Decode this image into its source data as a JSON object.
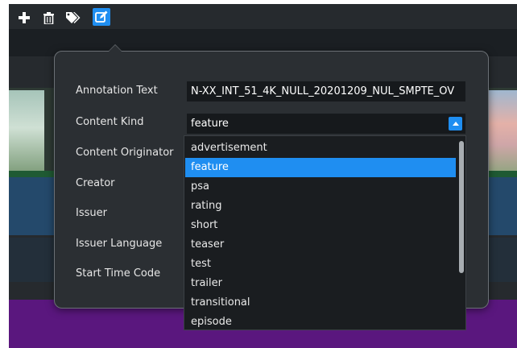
{
  "toolbar": {
    "icons": [
      "plus-icon",
      "trash-icon",
      "tags-icon",
      "edit-icon"
    ],
    "active_icon": "edit-icon"
  },
  "form": {
    "annotation_text_label": "Annotation Text",
    "annotation_text_value": "N-XX_INT_51_4K_NULL_20201209_NUL_SMPTE_OV",
    "content_kind_label": "Content Kind",
    "content_kind_value": "feature",
    "content_originator_label": "Content Originator",
    "creator_label": "Creator",
    "issuer_label": "Issuer",
    "issuer_language_label": "Issuer Language",
    "start_time_code_label": "Start Time Code"
  },
  "dropdown": {
    "options": [
      "advertisement",
      "feature",
      "psa",
      "rating",
      "short",
      "teaser",
      "test",
      "trailer",
      "transitional",
      "episode"
    ],
    "selected": "feature"
  },
  "colors": {
    "accent": "#1f8ef1",
    "panel": "#2b2f33",
    "track_purple": "#5a177e",
    "track_blue": "#24496b"
  }
}
